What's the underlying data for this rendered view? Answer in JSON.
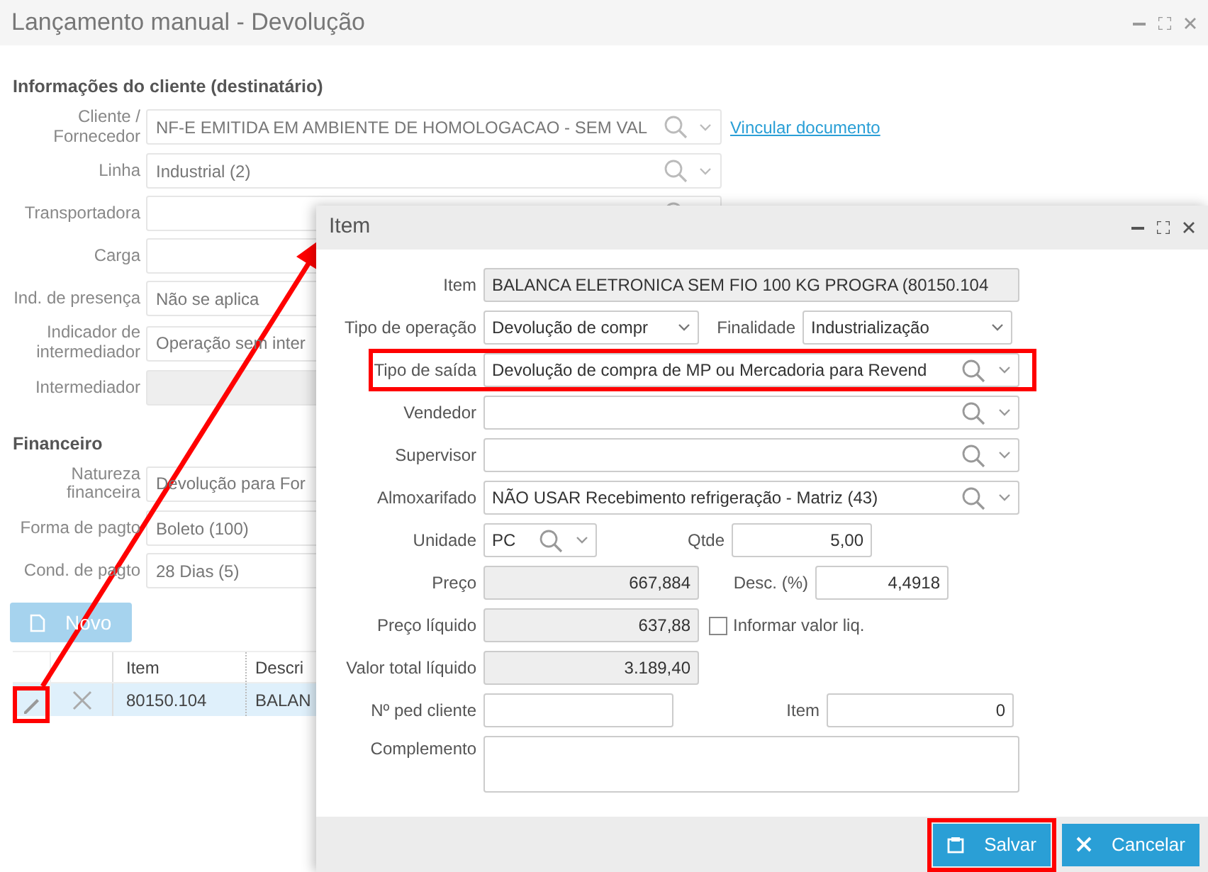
{
  "window": {
    "title": "Lançamento manual - Devolução"
  },
  "customer_section": {
    "heading": "Informações do cliente (destinatário)",
    "link": "Vincular documento",
    "fields": [
      {
        "label": "Cliente / Fornecedor",
        "value": "NF-E EMITIDA EM AMBIENTE DE HOMOLOGACAO - SEM VAL",
        "kind": "lookup"
      },
      {
        "label": "Linha",
        "value": "Industrial (2)",
        "kind": "lookup"
      },
      {
        "label": "Transportadora",
        "kind": "lookup"
      },
      {
        "label": "Carga"
      },
      {
        "label": "Ind. de presença",
        "value": "Não se aplica"
      },
      {
        "label": "Indicador de intermediador",
        "value": "Operação sem inter"
      },
      {
        "label": "Intermediador",
        "kind": "disabled"
      }
    ]
  },
  "financial_section": {
    "heading": "Financeiro",
    "fields": [
      {
        "label": "Natureza financeira",
        "value": "Devolução para For"
      },
      {
        "label": "Forma de pagto",
        "value": "Boleto (100)"
      },
      {
        "label": "Cond. de pagto",
        "value": "28 Dias (5)"
      }
    ]
  },
  "new_button": {
    "label": "Novo"
  },
  "items_table": {
    "columns": [
      "Item",
      "Descri"
    ],
    "rows": [
      {
        "cells": [
          "80150.104",
          "BALAN"
        ],
        "selected": true,
        "edit_highlighted": true
      }
    ]
  },
  "item_dialog": {
    "title": "Item",
    "rows": [
      {
        "highlighted": false,
        "fields": [
          {
            "label": "Item",
            "value": "BALANCA ELETRONICA SEM FIO 100 KG PROGRA (80150.104",
            "kind": "readonly"
          }
        ]
      },
      {
        "highlighted": false,
        "fields": [
          {
            "label": "Tipo de operação",
            "value": "Devolução de compr",
            "kind": "select"
          },
          {
            "label": "Finalidade",
            "value": "Industrialização",
            "kind": "select"
          }
        ]
      },
      {
        "highlighted": true,
        "fields": [
          {
            "label": "Tipo de saída",
            "value": "Devolução de compra de MP ou Mercadoria para Revend",
            "kind": "lookup"
          }
        ]
      },
      {
        "highlighted": false,
        "fields": [
          {
            "label": "Vendedor",
            "kind": "lookup"
          }
        ]
      },
      {
        "highlighted": false,
        "fields": [
          {
            "label": "Supervisor",
            "kind": "lookup"
          }
        ]
      },
      {
        "highlighted": false,
        "fields": [
          {
            "label": "Almoxarifado",
            "value": "NÃO USAR Recebimento refrigeração - Matriz (43)",
            "kind": "lookup"
          }
        ]
      },
      {
        "highlighted": false,
        "fields": [
          {
            "label": "Unidade",
            "value": "PC",
            "kind": "lookup"
          },
          {
            "label": "Qtde",
            "value": "5,00",
            "kind": "amount"
          }
        ]
      },
      {
        "highlighted": false,
        "fields": [
          {
            "label": "Preço",
            "value": "667,884",
            "kind": "readonly_amount"
          },
          {
            "label": "Desc. (%)",
            "value": "4,4918",
            "kind": "amount"
          }
        ]
      },
      {
        "highlighted": false,
        "fields": [
          {
            "label": "Preço líquido",
            "value": "637,88",
            "kind": "readonly_amount"
          },
          {
            "label": "Informar valor liq.",
            "kind": "checkbox",
            "checked": false
          }
        ]
      },
      {
        "highlighted": false,
        "fields": [
          {
            "label": "Valor total líquido",
            "value": "3.189,40",
            "kind": "readonly_amount"
          }
        ]
      },
      {
        "highlighted": false,
        "fields": [
          {
            "label": "Nº ped cliente",
            "kind": "text"
          },
          {
            "label": "Item",
            "value": "0",
            "kind": "amount"
          }
        ]
      },
      {
        "highlighted": false,
        "fields": [
          {
            "label": "Complemento",
            "kind": "textarea"
          }
        ]
      }
    ],
    "buttons": [
      {
        "label": "Salvar",
        "kind": "save",
        "highlighted": true
      },
      {
        "label": "Cancelar",
        "kind": "cancel",
        "highlighted": false
      }
    ]
  }
}
